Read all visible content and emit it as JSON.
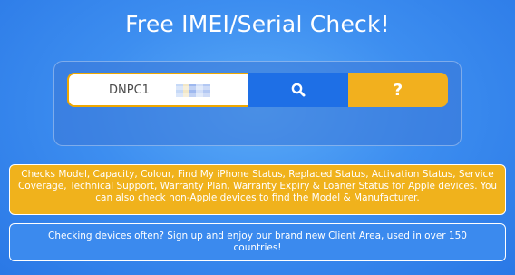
{
  "header": {
    "title": "Free IMEI/Serial Check!"
  },
  "search": {
    "value": "DNPC1",
    "search_icon": "search-icon",
    "help_label": "?"
  },
  "info": {
    "text": "Checks Model, Capacity, Colour, Find My iPhone Status, Replaced Status, Activation Status, Service Coverage, Technical Support, Warranty Plan, Warranty Expiry & Loaner Status for Apple devices. You can also check non-Apple devices to find the Model & Manufacturer."
  },
  "signup": {
    "text": "Checking devices often? Sign up and enjoy our brand new Client Area, used in over 150 countries!"
  },
  "colors": {
    "background": "#3d8ef0",
    "search_button": "#1e6fe6",
    "help_button": "#f2b01e",
    "info_box": "#f0b21c",
    "signup_box": "#3b8aee"
  }
}
